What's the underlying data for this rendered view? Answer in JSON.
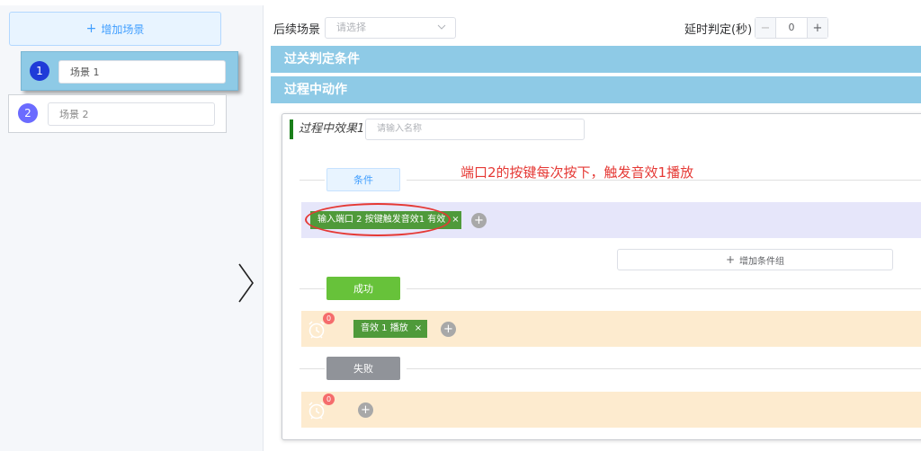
{
  "sidebar": {
    "add_scene_label": "增加场景",
    "scenes": [
      {
        "number": "1",
        "name": "场景 1"
      },
      {
        "number": "2",
        "name": "场景 2"
      }
    ]
  },
  "toprow": {
    "next_scene_label": "后续场景",
    "next_scene_placeholder": "请选择",
    "delay_label": "延时判定(秒)",
    "delay_value": "0"
  },
  "sections": {
    "pass_condition": "过关判定条件",
    "process_action": "过程中动作"
  },
  "effect": {
    "title": "过程中效果1",
    "name_placeholder": "请输入名称",
    "condition_tag": "条件",
    "annotation": "端口2的按键每次按下，触发音效1播放",
    "condition_chip": "输入端口 2 按键触发音效1 有效",
    "add_group_label": "增加条件组",
    "success_tag": "成功",
    "success_badge": "0",
    "success_chip": "音效 1 播放",
    "fail_tag": "失败",
    "fail_badge": "0"
  },
  "colors": {
    "accent": "#409eff",
    "bar": "#8ecae6",
    "success": "#67c23a",
    "fail": "#909399",
    "annotation": "#e53935"
  }
}
